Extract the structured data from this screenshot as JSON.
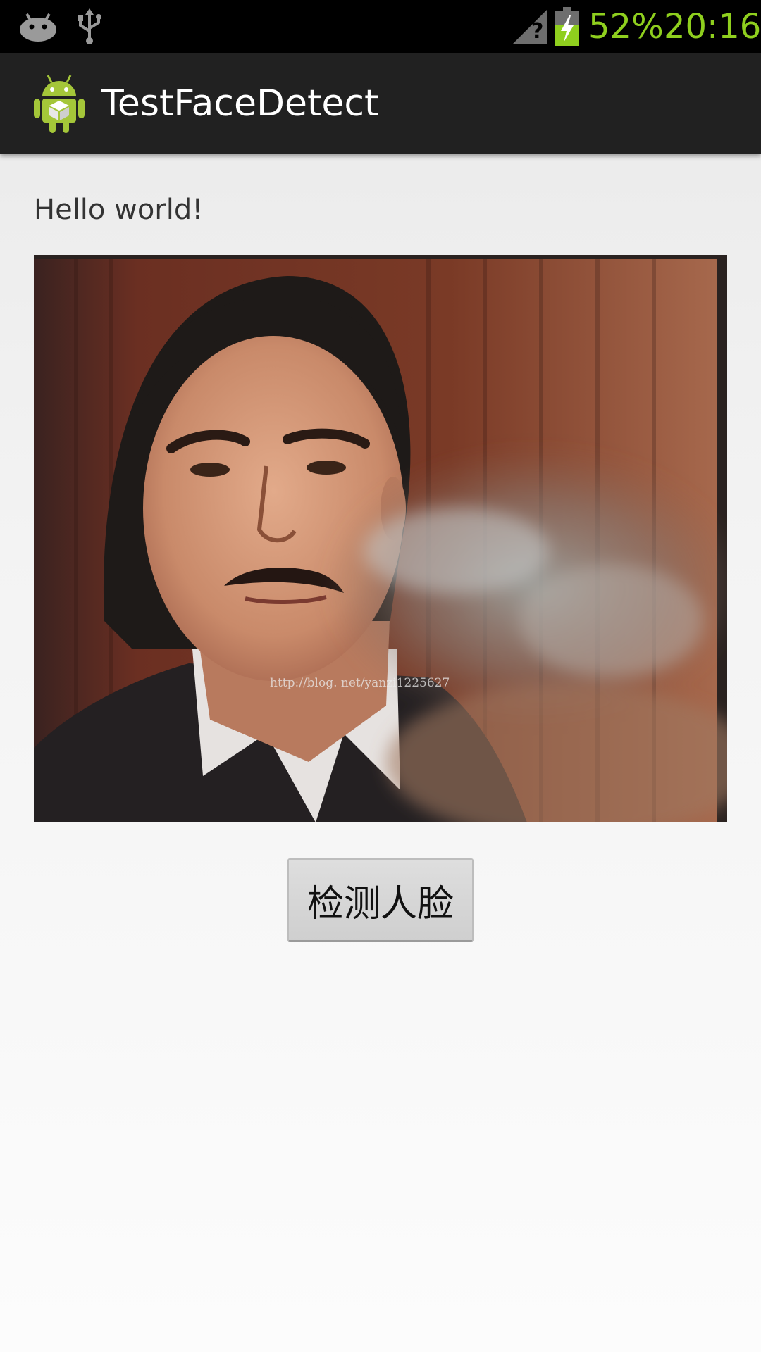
{
  "status_bar": {
    "left_icons": [
      "android-debug-icon",
      "usb-icon"
    ],
    "right_icons": [
      "signal-unknown-icon",
      "battery-charging-icon"
    ],
    "battery_percent": "52%",
    "time": "20:16",
    "text_color": "#8fcf1e"
  },
  "action_bar": {
    "icon": "android-app-icon",
    "title": "TestFaceDetect",
    "background": "#212121"
  },
  "content": {
    "hello_text": "Hello world!",
    "image": {
      "subject": "face-photo",
      "watermark": "http://blog.      net/yanzi1225627"
    },
    "detect_button_label": "检测人脸"
  }
}
